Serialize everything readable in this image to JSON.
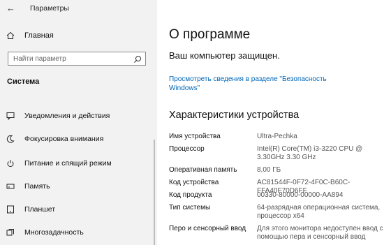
{
  "app": {
    "title": "Параметры"
  },
  "sidebar": {
    "home_label": "Главная",
    "search_placeholder": "Найти параметр",
    "section_title": "Система",
    "items": [
      {
        "label": "Уведомления и действия",
        "icon": "message-icon"
      },
      {
        "label": "Фокусировка внимания",
        "icon": "moon-icon"
      },
      {
        "label": "Питание и спящий режим",
        "icon": "power-icon"
      },
      {
        "label": "Память",
        "icon": "storage-icon"
      },
      {
        "label": "Планшет",
        "icon": "tablet-icon"
      },
      {
        "label": "Многозадачность",
        "icon": "multitasking-icon"
      }
    ]
  },
  "main": {
    "title": "О программе",
    "protected": "Ваш компьютер защищен.",
    "security_link": "Просмотреть сведения в разделе \"Безопасность Windows\"",
    "specs_title": "Характеристики устройства",
    "specs": [
      {
        "key": "Имя устройства",
        "value": "Ultra-Pechka"
      },
      {
        "key": "Процессор",
        "value": "Intel(R) Core(TM) i3-3220 CPU @ 3.30GHz 3.30 GHz"
      },
      {
        "key": "Оперативная память",
        "value": "8,00 ГБ"
      },
      {
        "key": "Код устройства",
        "value": "AC81544F-0F72-4F0C-B60C-FFA40F70D6FF"
      },
      {
        "key": "Код продукта",
        "value": "00330-80000-00000-AA894"
      },
      {
        "key": "Тип системы",
        "value": "64-разрядная операционная система, процессор x64"
      },
      {
        "key": "Перо и сенсорный ввод",
        "value": "Для этого монитора недоступен ввод с помощью пера и сенсорный ввод"
      }
    ]
  },
  "colors": {
    "sidebar_bg": "#f2f2f2",
    "link": "#0067b8"
  }
}
